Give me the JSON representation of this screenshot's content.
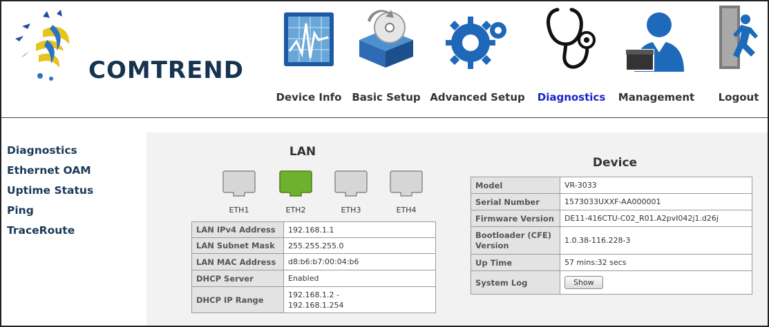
{
  "brand": {
    "name": "COMTREND"
  },
  "nav": [
    {
      "label": "Device Info",
      "icon": "chart-monitor-icon",
      "active": false
    },
    {
      "label": "Basic Setup",
      "icon": "box-disc-icon",
      "active": false
    },
    {
      "label": "Advanced Setup",
      "icon": "gears-icon",
      "active": false
    },
    {
      "label": "Diagnostics",
      "icon": "stethoscope-icon",
      "active": true
    },
    {
      "label": "Management",
      "icon": "user-icon",
      "active": false
    },
    {
      "label": "Logout",
      "icon": "exit-door-icon",
      "active": false
    }
  ],
  "sidebar": {
    "items": [
      {
        "label": "Diagnostics"
      },
      {
        "label": "Ethernet OAM"
      },
      {
        "label": "Uptime Status"
      },
      {
        "label": "Ping"
      },
      {
        "label": "TraceRoute"
      }
    ]
  },
  "lan": {
    "title": "LAN",
    "ports": [
      {
        "label": "ETH1",
        "status": "inactive",
        "color": "#d6d6d6"
      },
      {
        "label": "ETH2",
        "status": "active",
        "color": "#6fb02e"
      },
      {
        "label": "ETH3",
        "status": "inactive",
        "color": "#d6d6d6"
      },
      {
        "label": "ETH4",
        "status": "inactive",
        "color": "#d6d6d6"
      }
    ],
    "rows": [
      {
        "key": "LAN IPv4 Address",
        "value": "192.168.1.1"
      },
      {
        "key": "LAN Subnet Mask",
        "value": "255.255.255.0"
      },
      {
        "key": "LAN MAC Address",
        "value": "d8:b6:b7:00:04:b6"
      },
      {
        "key": "DHCP Server",
        "value": "Enabled"
      },
      {
        "key": "DHCP IP Range",
        "value": "192.168.1.2 -\n192.168.1.254"
      }
    ]
  },
  "device": {
    "title": "Device",
    "rows": [
      {
        "key": "Model",
        "value": "VR-3033"
      },
      {
        "key": "Serial Number",
        "value": "1573033UXXF-AA000001"
      },
      {
        "key": "Firmware Version",
        "value": "DE11-416CTU-C02_R01.A2pvI042j1.d26j"
      },
      {
        "key": "Bootloader (CFE) Version",
        "value": "1.0.38-116.228-3"
      },
      {
        "key": "Up Time",
        "value": "57 mins:32 secs"
      }
    ],
    "system_log": {
      "key": "System Log",
      "button_label": "Show"
    }
  },
  "colors": {
    "brand": "#16344f",
    "active_nav": "#1a24c8",
    "port_active": "#6fb02e"
  }
}
